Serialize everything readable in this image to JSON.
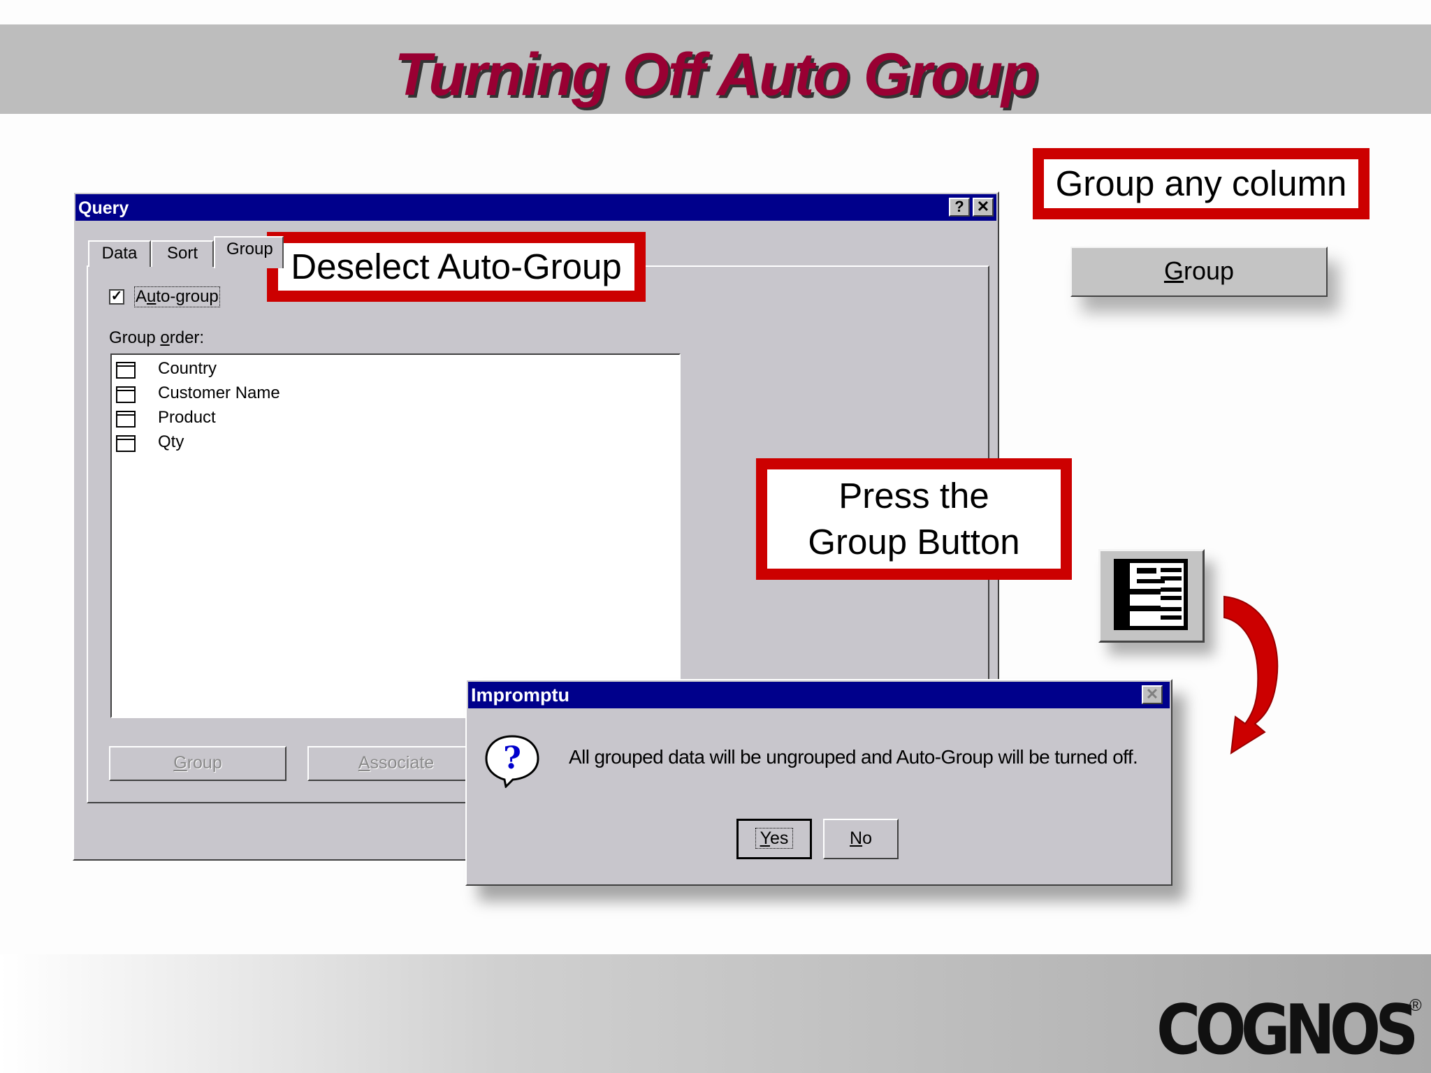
{
  "slide": {
    "title": "Turning Off Auto Group",
    "logo_text": "COGNOS",
    "logo_mark": "®"
  },
  "query_dialog": {
    "title": "Query",
    "help_btn": "?",
    "close_btn": "✕",
    "tabs": [
      {
        "label": "Data"
      },
      {
        "label": "Sort"
      },
      {
        "label": "Group"
      }
    ],
    "auto_group": {
      "checked": true,
      "check_mark": "✓",
      "label_prefix": "A",
      "label_accel": "u",
      "label_suffix": "to-group"
    },
    "group_order": {
      "label_prefix": "Group ",
      "label_accel": "o",
      "label_suffix": "rder:"
    },
    "items": [
      "Country",
      "Customer Name",
      "Product",
      "Qty"
    ],
    "group_button": {
      "accel": "G",
      "rest": "roup"
    },
    "associate_button": {
      "accel": "A",
      "rest": "ssociate"
    }
  },
  "impromptu_dialog": {
    "title": "Impromptu",
    "close_btn": "✕",
    "icon": "question-bubble-icon",
    "message": "All grouped data will be ungrouped and Auto-Group will be turned off.",
    "yes_button": {
      "accel": "Y",
      "rest": "es"
    },
    "no_button": {
      "accel": "N",
      "rest": "o"
    }
  },
  "callouts": {
    "deselect": "Deselect Auto-Group",
    "group_any": "Group any column",
    "press_line1": "Press the",
    "press_line2": "Group Button"
  },
  "standalone_group_button": {
    "accel": "G",
    "rest": "roup"
  },
  "colors": {
    "title": "#990033",
    "callout_border": "#cc0000",
    "window_title": "#00008b",
    "arrow": "#cc0000"
  }
}
